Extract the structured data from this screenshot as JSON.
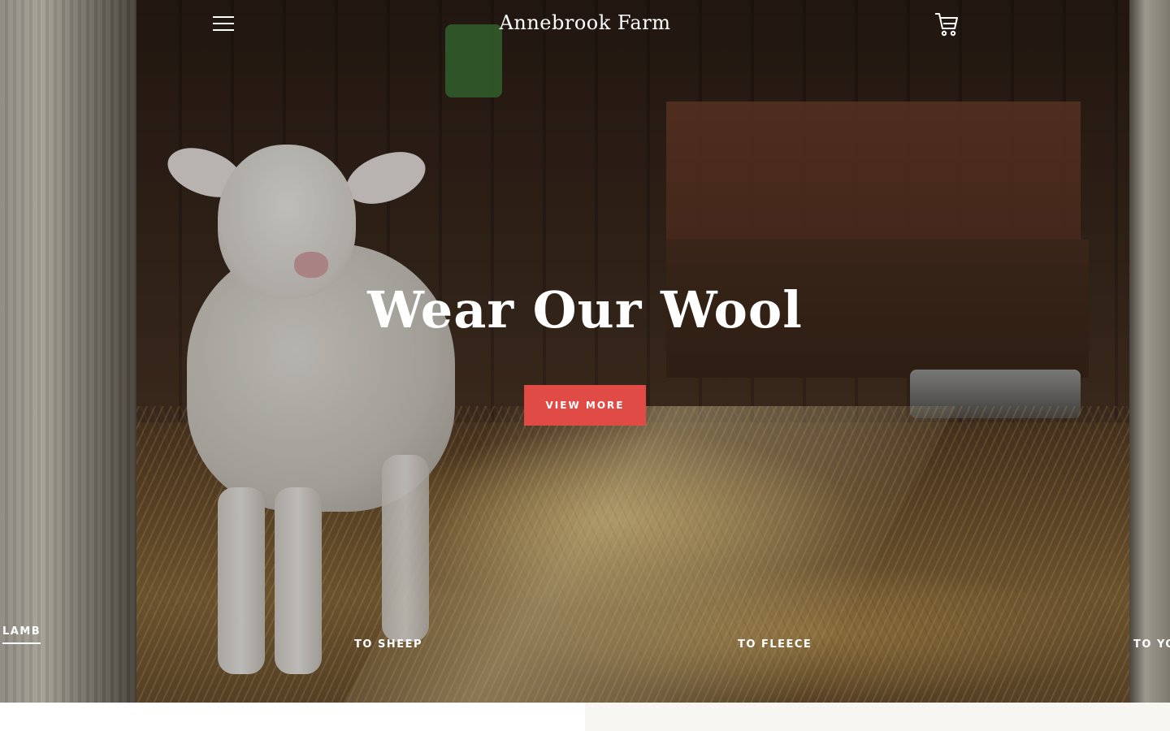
{
  "header": {
    "site_title": "Annebrook Farm",
    "menu_icon": "hamburger-menu-icon",
    "cart_icon": "shopping-cart-icon"
  },
  "hero": {
    "heading": "Wear Our Wool",
    "cta_label": "VIEW MORE",
    "cta_color": "#e04b45",
    "image": "lamb-in-barn-photo"
  },
  "slides": {
    "items": [
      {
        "label": "LAMB",
        "active": true
      },
      {
        "label": "TO SHEEP",
        "active": false
      },
      {
        "label": "TO FLEECE",
        "active": false
      },
      {
        "label": "TO YO",
        "active": false
      }
    ]
  }
}
